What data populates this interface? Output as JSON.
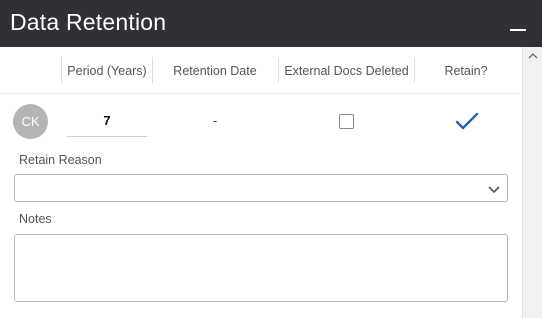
{
  "window": {
    "title": "Data Retention"
  },
  "columns": {
    "period": "Period (Years)",
    "retention_date": "Retention Date",
    "external_docs_deleted": "External Docs Deleted",
    "retain": "Retain?"
  },
  "row": {
    "avatar_initials": "CK",
    "period_value": "7",
    "retention_date_value": "-",
    "external_docs_deleted_checked": false,
    "retain_checked": true
  },
  "form": {
    "retain_reason_label": "Retain Reason",
    "retain_reason_value": "",
    "notes_label": "Notes",
    "notes_value": ""
  },
  "colors": {
    "header_bg": "#2f3137",
    "check_blue": "#2c5fb3",
    "avatar_bg": "#b5b5b5"
  }
}
